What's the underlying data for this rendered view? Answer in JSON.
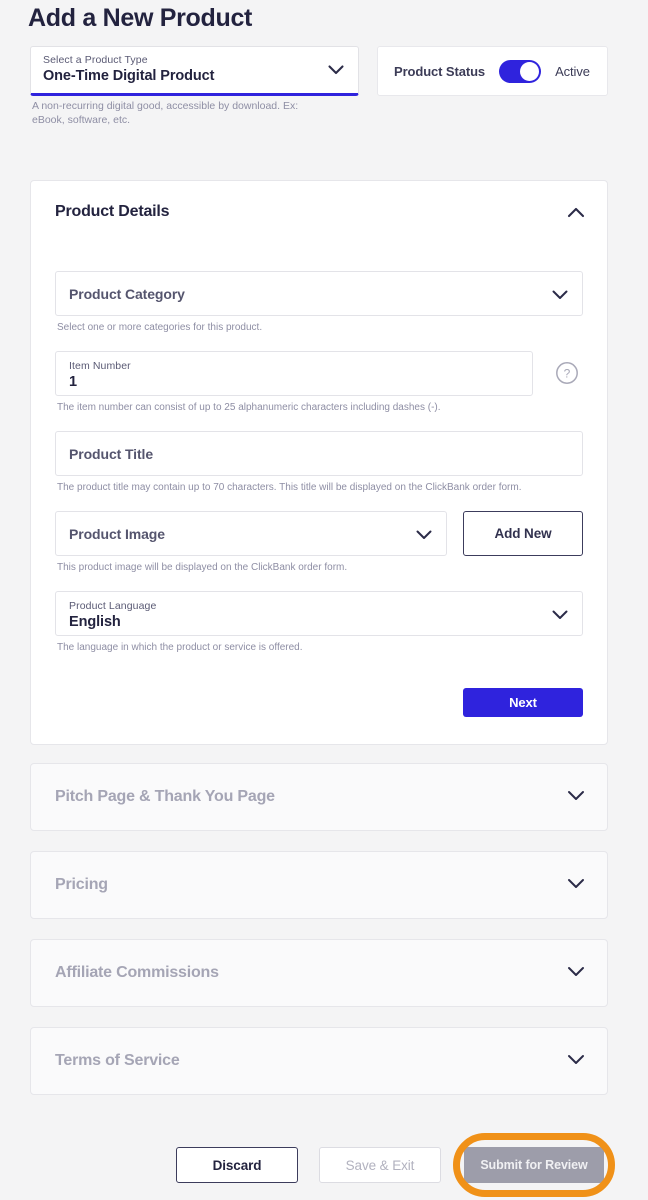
{
  "header": {
    "title": "Add a New Product",
    "product_type": {
      "label": "Select a Product Type",
      "value": "One-Time Digital Product",
      "help": "A non-recurring digital good, accessible by download. Ex: eBook, software, etc.",
      "chevron_icon": "chevron-down-icon"
    },
    "product_status": {
      "label": "Product Status",
      "state": "Active",
      "toggle_on": true
    }
  },
  "details_card": {
    "title": "Product Details",
    "expanded": true,
    "chevron_icon": "chevron-up-icon",
    "fields": {
      "category": {
        "placeholder": "Product Category",
        "help": "Select one or more categories for this product.",
        "chevron_icon": "chevron-down-icon"
      },
      "item_number": {
        "label": "Item Number",
        "value": "1",
        "help": "The item number can consist of up to 25 alphanumeric characters including dashes (-).",
        "help_icon": "question-mark-circle-icon"
      },
      "product_title": {
        "placeholder": "Product Title",
        "help": "The product title may contain up to 70 characters. This title will be displayed on the ClickBank order form."
      },
      "product_image": {
        "placeholder": "Product Image",
        "help": "This product image will be displayed on the ClickBank order form.",
        "chevron_icon": "chevron-down-icon",
        "add_new_label": "Add New"
      },
      "product_language": {
        "label": "Product Language",
        "value": "English",
        "help": "The language in which the product or service is offered.",
        "chevron_icon": "chevron-down-icon"
      }
    },
    "next_label": "Next"
  },
  "sections": [
    {
      "title": "Pitch Page & Thank You Page",
      "chevron_icon": "chevron-down-icon"
    },
    {
      "title": "Pricing",
      "chevron_icon": "chevron-down-icon"
    },
    {
      "title": "Affiliate Commissions",
      "chevron_icon": "chevron-down-icon"
    },
    {
      "title": "Terms of Service",
      "chevron_icon": "chevron-down-icon"
    }
  ],
  "footer": {
    "discard_label": "Discard",
    "save_exit_label": "Save & Exit",
    "submit_label": "Submit for Review",
    "submit_disabled": true,
    "highlight_color": "#f09118"
  },
  "colors": {
    "accent": "#2f23dd",
    "page_background": "#f4f4f5",
    "text_dark": "#23233f",
    "text_muted": "#8e8ea4",
    "disabled_gray": "#9d9daa"
  }
}
